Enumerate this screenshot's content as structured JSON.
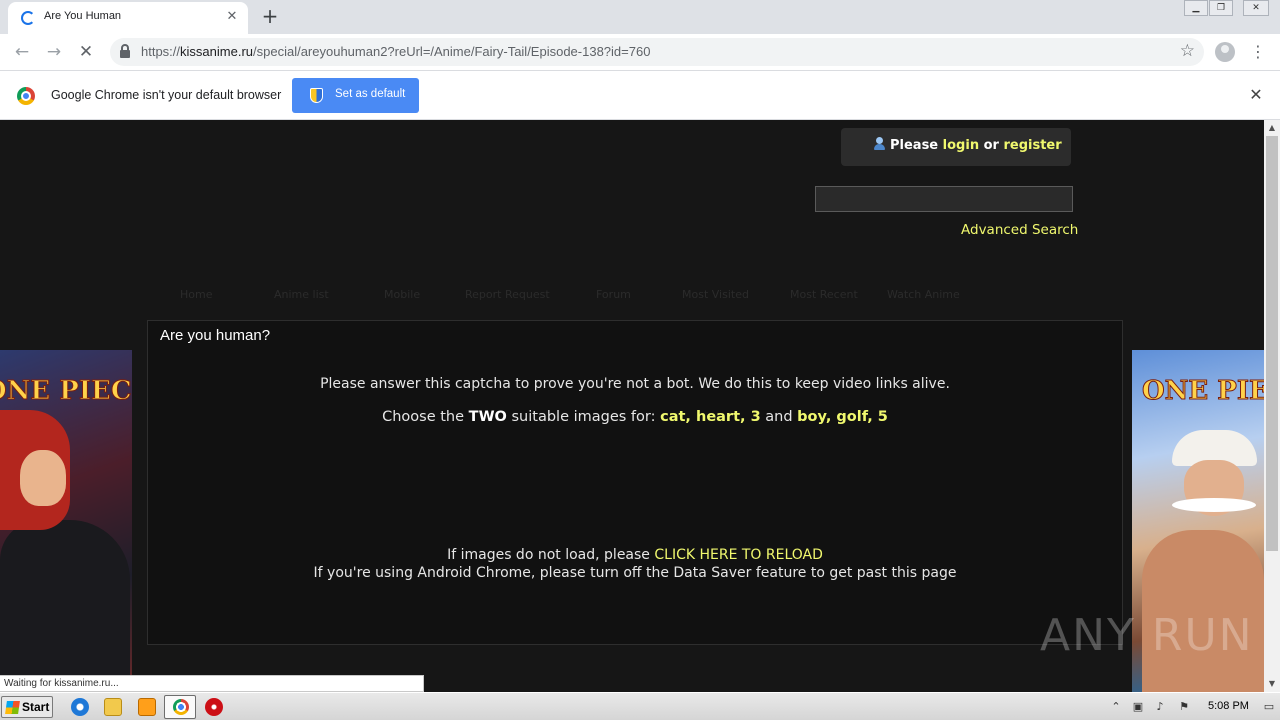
{
  "browser": {
    "tab_title": "Are You Human",
    "url_prefix": "https://",
    "url_host": "kissanime.ru",
    "url_path": "/special/areyouhuman2?reUrl=/Anime/Fairy-Tail/Episode-138?id=760",
    "infobar_message": "Google Chrome isn't your default browser",
    "set_default_label": "Set as default",
    "status_text": "Waiting for kissanime.ru..."
  },
  "site": {
    "login_prefix": "Please",
    "login_link": "login",
    "login_or": "or",
    "register_link": "register",
    "search_value": "",
    "advanced_search": "Advanced Search",
    "nav_items": [
      "Home",
      "Anime list",
      "Mobile",
      "Report Request",
      "Forum",
      "Most Visited",
      "Most Recent",
      "Watch Anime"
    ]
  },
  "captcha": {
    "title": "Are you human?",
    "instruction": "Please answer this captcha to prove you're not a bot. We do this to keep video links alive.",
    "choose_prefix": "Choose the",
    "choose_count": "TWO",
    "choose_middle": "suitable images for:",
    "keywords_1": "cat, heart, 3",
    "choose_and": "and",
    "keywords_2": "boy, golf, 5",
    "reload_prefix": "If images do not load, please",
    "reload_link": "CLICK HERE TO RELOAD",
    "android_note": "If you're using Android Chrome, please turn off the Data Saver feature to get past this page"
  },
  "banners": {
    "left_logo": "ONE PIECE",
    "right_logo": "ONE PIECE"
  },
  "watermark": "ANY RUN",
  "taskbar": {
    "start_label": "Start",
    "clock": "5:08 PM"
  },
  "colors": {
    "accent_yellow": "#f0f86e",
    "page_bg": "#161616",
    "chrome_blue": "#4a8af4"
  },
  "icons": {
    "tab_loading": "spinner-icon",
    "back": "arrow-left-icon",
    "forward": "arrow-right-icon",
    "stop": "close-icon",
    "lock": "lock-icon",
    "bookmark": "star-icon",
    "profile": "avatar-icon",
    "menu": "kebab-menu-icon"
  }
}
